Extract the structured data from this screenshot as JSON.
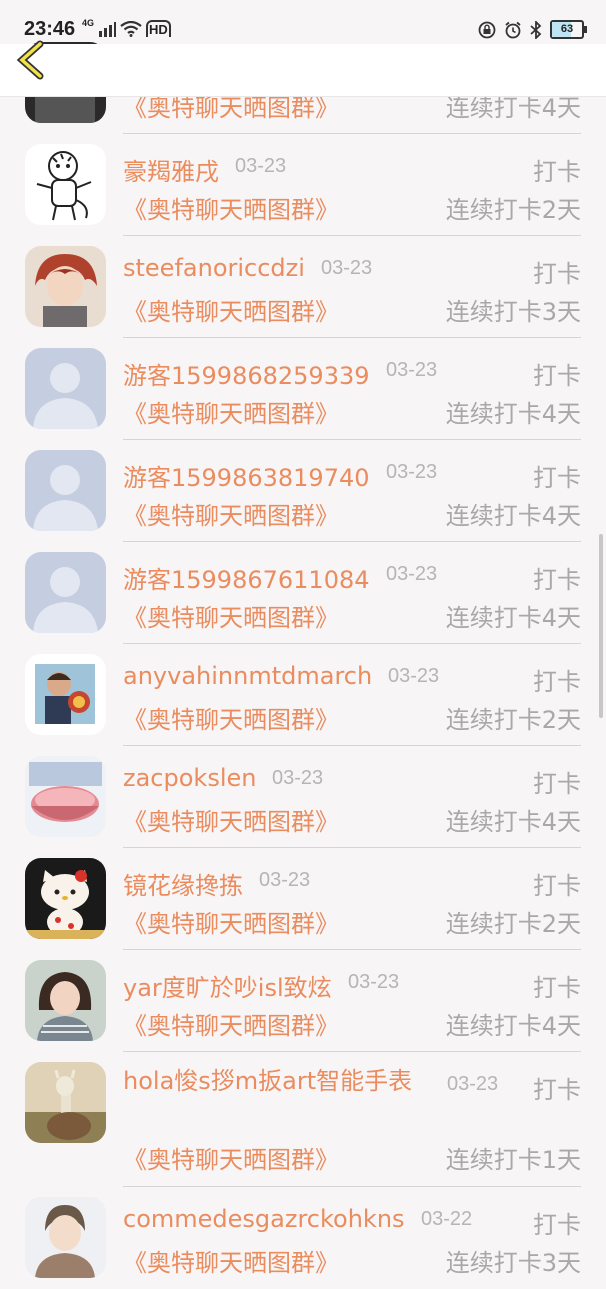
{
  "status": {
    "time": "23:46",
    "network": "4G",
    "hd": "HD",
    "battery": "63",
    "battery_level": 0.63
  },
  "list": [
    {
      "name": "",
      "date": "",
      "action": "",
      "group": "《奥特聊天晒图群》",
      "streak": "连续打卡4天",
      "avatar": "bw-photo-partial"
    },
    {
      "name": "豪羯雅戌",
      "date": "03-23",
      "action": "打卡",
      "group": "《奥特聊天晒图群》",
      "streak": "连续打卡2天",
      "avatar": "cartoon-tiger"
    },
    {
      "name": "steefanoriccdzi",
      "date": "03-23",
      "action": "打卡",
      "group": "《奥特聊天晒图群》",
      "streak": "连续打卡3天",
      "avatar": "anime-red-hair"
    },
    {
      "name": "游客1599868259339",
      "date": "03-23",
      "action": "打卡",
      "group": "《奥特聊天晒图群》",
      "streak": "连续打卡4天",
      "avatar": "default-person"
    },
    {
      "name": "游客1599863819740",
      "date": "03-23",
      "action": "打卡",
      "group": "《奥特聊天晒图群》",
      "streak": "连续打卡4天",
      "avatar": "default-person"
    },
    {
      "name": "游客1599867611084",
      "date": "03-23",
      "action": "打卡",
      "group": "《奥特聊天晒图群》",
      "streak": "连续打卡4天",
      "avatar": "default-person"
    },
    {
      "name": "anyvahinnmtdmarch",
      "date": "03-23",
      "action": "打卡",
      "group": "《奥特聊天晒图群》",
      "streak": "连续打卡2天",
      "avatar": "man-with-flower"
    },
    {
      "name": "zacpokslen",
      "date": "03-23",
      "action": "打卡",
      "group": "《奥特聊天晒图群》",
      "streak": "连续打卡4天",
      "avatar": "dessert-bowl"
    },
    {
      "name": "镜花缘搀拣",
      "date": "03-23",
      "action": "打卡",
      "group": "《奥特聊天晒图群》",
      "streak": "连续打卡2天",
      "avatar": "hello-kitty"
    },
    {
      "name": "yar度旷於吵isl致炫",
      "date": "03-23",
      "action": "打卡",
      "group": "《奥特聊天晒图群》",
      "streak": "连续打卡4天",
      "avatar": "little-girl"
    },
    {
      "name": "hola悛s拶m扳art智能手表",
      "date": "03-23",
      "action": "打卡",
      "group": "《奥特聊天晒图群》",
      "streak": "连续打卡1天",
      "avatar": "alpaca"
    },
    {
      "name": "commedesgazrckohkns",
      "date": "03-22",
      "action": "打卡",
      "group": "《奥特聊天晒图群》",
      "streak": "连续打卡3天",
      "avatar": "cartoon-boy"
    }
  ]
}
